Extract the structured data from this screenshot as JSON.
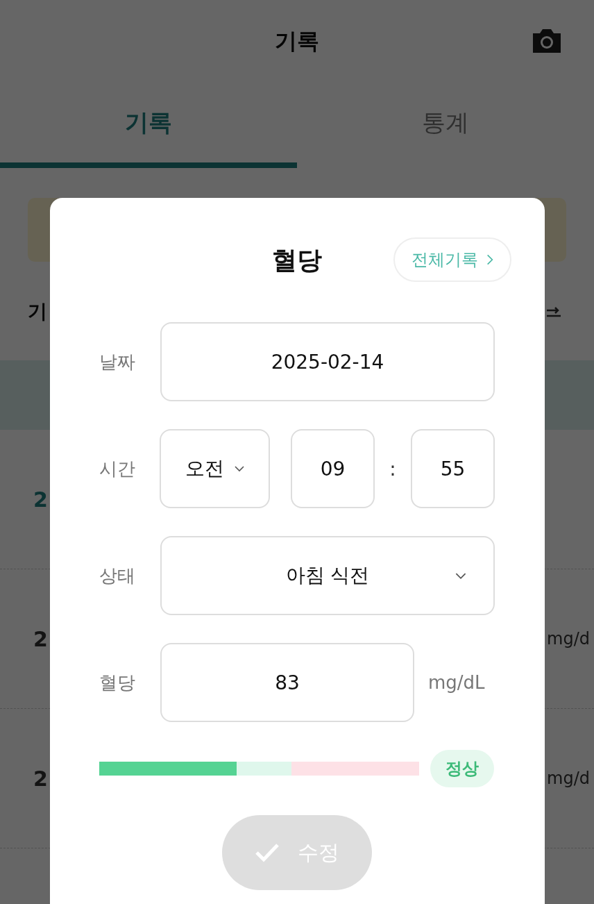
{
  "header": {
    "title": "기록"
  },
  "tabs": [
    {
      "label": "기록",
      "selected": true
    },
    {
      "label": "통계",
      "selected": false
    }
  ],
  "background": {
    "section_title": "기",
    "row_dates": [
      "2",
      "2",
      "2"
    ],
    "row_units": [
      "mg/d",
      "mg/d"
    ]
  },
  "dialog": {
    "title": "혈당",
    "all_records_link": "전체기록",
    "date": {
      "label": "날짜",
      "value": "2025-02-14"
    },
    "time": {
      "label": "시간",
      "meridiem": "오전",
      "hour": "09",
      "separator": ":",
      "minute": "55"
    },
    "state": {
      "label": "상태",
      "value": "아침 식전"
    },
    "glucose": {
      "label": "혈당",
      "value": "83",
      "unit": "mg/dL"
    },
    "gauge": {
      "level": 0.43
    },
    "status": {
      "label": "정상",
      "kind": "normal"
    },
    "submit": {
      "label": "수정",
      "disabled": true
    }
  }
}
